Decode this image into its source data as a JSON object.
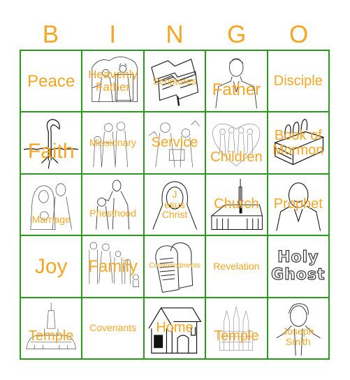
{
  "header": [
    "B",
    "I",
    "N",
    "G",
    "O"
  ],
  "colors": {
    "accent": "#f5a623",
    "grid": "#2a9a1a"
  },
  "cells": [
    {
      "label": "Peace",
      "icon": "none"
    },
    {
      "label": "Heavenly Father",
      "icon": "heavenly-father-illustration"
    },
    {
      "label": "Scriptures",
      "icon": "open-books-illustration"
    },
    {
      "label": "Father",
      "icon": "man-portrait-illustration"
    },
    {
      "label": "Disciple",
      "icon": "none"
    },
    {
      "label": "Faith",
      "icon": "sprouting-seed-illustration"
    },
    {
      "label": "Missionary",
      "icon": "missionaries-illustration"
    },
    {
      "label": "Service",
      "icon": "service-illustration"
    },
    {
      "label": "Children",
      "icon": "children-heart-illustration"
    },
    {
      "label": "Book of Mormon",
      "icon": "book-of-mormon-illustration"
    },
    {
      "label": "Marriage",
      "icon": "bride-groom-illustration"
    },
    {
      "label": "Priesthood",
      "icon": "priesthood-blessing-illustration"
    },
    {
      "label": "Jesus Christ",
      "label_lines": [
        "J",
        "esus",
        "Christ"
      ],
      "icon": "jesus-portrait-illustration"
    },
    {
      "label": "Church",
      "icon": "chapel-illustration"
    },
    {
      "label": "Prophet",
      "icon": "prophet-portrait-illustration"
    },
    {
      "label": "Joy",
      "icon": "none"
    },
    {
      "label": "Family",
      "icon": "family-illustration"
    },
    {
      "label": "Commandments",
      "icon": "stone-tablets-illustration"
    },
    {
      "label": "Revelation",
      "icon": "none"
    },
    {
      "label": "Holy Ghost",
      "label_lines": [
        "Holy",
        "Ghost"
      ],
      "icon": "outlined-text-image"
    },
    {
      "label": "Temple",
      "icon": "temple-illustration"
    },
    {
      "label": "Covenants",
      "icon": "none"
    },
    {
      "label": "Home",
      "icon": "house-illustration"
    },
    {
      "label": "Temple",
      "icon": "salt-lake-temple-illustration"
    },
    {
      "label": "Joseph Smith",
      "label_lines": [
        "Joseph",
        "Smith"
      ],
      "icon": "joseph-smith-portrait-illustration"
    }
  ]
}
